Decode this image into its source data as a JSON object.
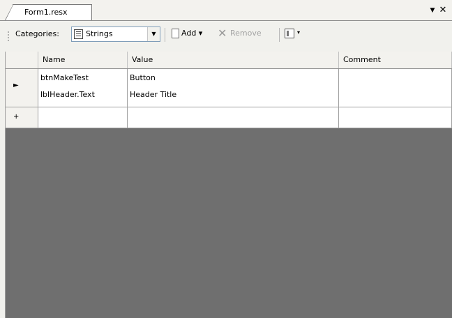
{
  "window": {
    "tab_title": "Form1.resx",
    "tab_menu_glyph": "▼",
    "tab_close_glyph": "✕"
  },
  "toolbar": {
    "categories_label": "Categories:",
    "category_value": "Strings",
    "category_icon": "strings-icon",
    "dropdown_glyph": "▼",
    "add_label": "Add ▾",
    "add_icon": "new-document-icon",
    "remove_label": "Remove",
    "remove_icon": "delete-x-icon",
    "views_icon": "views-icon",
    "views_arrow": "▾"
  },
  "grid": {
    "columns": [
      "Name",
      "Value",
      "Comment"
    ],
    "rows": [
      {
        "marker": "►",
        "name": "btnMakeTest",
        "name_second_line": "lblHeader.Text",
        "value": "Button",
        "value_second_line": "Header Title",
        "comment": ""
      }
    ],
    "new_row": {
      "marker": "+",
      "name": "",
      "value": "",
      "comment": ""
    }
  }
}
